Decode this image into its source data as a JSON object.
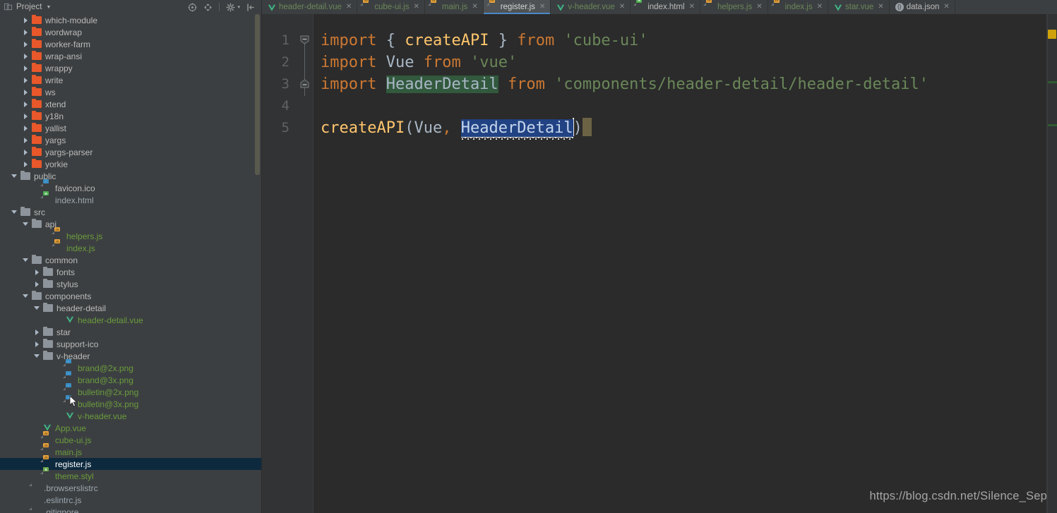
{
  "window": {
    "project_panel_title": "Project",
    "watermark": "https://blog.csdn.net/Silence_Sep"
  },
  "colors": {
    "background": "#2b2b2b",
    "panel": "#3c3f41",
    "selection_row": "#0d293e",
    "active_tab_underline": "#4a88c7",
    "folder_orange": "#e8582a",
    "folder_grey": "#8d949b",
    "text_default": "#bbbbbb",
    "text_vcs_green": "#6a9c3d",
    "vue_teal": "#4fc08d",
    "keyword_orange": "#cc7832",
    "string_green": "#6a8759",
    "function_yellow": "#ffc66d",
    "identifier": "#a9b7c6",
    "code_selection": "#214283",
    "highlight_green": "#32593d",
    "warning_marker": "#cfa20b",
    "change_marker": "#2f5c2f"
  },
  "toolbar": {
    "icons": [
      {
        "name": "locate-icon",
        "title": "Select Opened File"
      },
      {
        "name": "expand-collapse-icon",
        "title": "Expand All"
      },
      {
        "name": "gear-icon",
        "title": "Settings"
      },
      {
        "name": "collapse-panel-icon",
        "title": "Hide"
      }
    ]
  },
  "tabs": [
    {
      "label": "header-detail.vue",
      "icon": "vue-icon",
      "active": false,
      "green": true
    },
    {
      "label": "cube-ui.js",
      "icon": "js-icon",
      "active": false,
      "green": true
    },
    {
      "label": "main.js",
      "icon": "js-icon",
      "active": false,
      "green": true
    },
    {
      "label": "register.js",
      "icon": "js-icon",
      "active": true,
      "green": true
    },
    {
      "label": "v-header.vue",
      "icon": "vue-icon",
      "active": false,
      "green": true
    },
    {
      "label": "index.html",
      "icon": "html-icon",
      "active": false,
      "green": false
    },
    {
      "label": "helpers.js",
      "icon": "js-icon",
      "active": false,
      "green": true
    },
    {
      "label": "index.js",
      "icon": "js-icon",
      "active": false,
      "green": true
    },
    {
      "label": "star.vue",
      "icon": "vue-icon",
      "active": false,
      "green": true
    },
    {
      "label": "data.json",
      "icon": "json-icon",
      "active": false,
      "green": false
    }
  ],
  "tab_close_glyph": "✕",
  "tree": [
    {
      "label": "which-module",
      "indent": 1,
      "type": "folder",
      "folder_color": "orange",
      "arrow": "collapsed",
      "style": "default",
      "selected": false
    },
    {
      "label": "wordwrap",
      "indent": 1,
      "type": "folder",
      "folder_color": "orange",
      "arrow": "collapsed",
      "style": "default",
      "selected": false
    },
    {
      "label": "worker-farm",
      "indent": 1,
      "type": "folder",
      "folder_color": "orange",
      "arrow": "collapsed",
      "style": "default",
      "selected": false
    },
    {
      "label": "wrap-ansi",
      "indent": 1,
      "type": "folder",
      "folder_color": "orange",
      "arrow": "collapsed",
      "style": "default",
      "selected": false
    },
    {
      "label": "wrappy",
      "indent": 1,
      "type": "folder",
      "folder_color": "orange",
      "arrow": "collapsed",
      "style": "default",
      "selected": false
    },
    {
      "label": "write",
      "indent": 1,
      "type": "folder",
      "folder_color": "orange",
      "arrow": "collapsed",
      "style": "default",
      "selected": false
    },
    {
      "label": "ws",
      "indent": 1,
      "type": "folder",
      "folder_color": "orange",
      "arrow": "collapsed",
      "style": "default",
      "selected": false
    },
    {
      "label": "xtend",
      "indent": 1,
      "type": "folder",
      "folder_color": "orange",
      "arrow": "collapsed",
      "style": "default",
      "selected": false
    },
    {
      "label": "y18n",
      "indent": 1,
      "type": "folder",
      "folder_color": "orange",
      "arrow": "collapsed",
      "style": "default",
      "selected": false
    },
    {
      "label": "yallist",
      "indent": 1,
      "type": "folder",
      "folder_color": "orange",
      "arrow": "collapsed",
      "style": "default",
      "selected": false
    },
    {
      "label": "yargs",
      "indent": 1,
      "type": "folder",
      "folder_color": "orange",
      "arrow": "collapsed",
      "style": "default",
      "selected": false
    },
    {
      "label": "yargs-parser",
      "indent": 1,
      "type": "folder",
      "folder_color": "orange",
      "arrow": "collapsed",
      "style": "default",
      "selected": false
    },
    {
      "label": "yorkie",
      "indent": 1,
      "type": "folder",
      "folder_color": "orange",
      "arrow": "collapsed",
      "style": "default",
      "selected": false
    },
    {
      "label": "public",
      "indent": 0,
      "type": "folder",
      "folder_color": "grey",
      "arrow": "expanded",
      "style": "default",
      "selected": false
    },
    {
      "label": "favicon.ico",
      "indent": 2,
      "type": "file",
      "file_icon": "img-icon",
      "arrow": "none",
      "style": "default",
      "selected": false
    },
    {
      "label": "index.html",
      "indent": 2,
      "type": "file",
      "file_icon": "html-icon",
      "arrow": "none",
      "style": "blue",
      "selected": false
    },
    {
      "label": "src",
      "indent": 0,
      "type": "folder",
      "folder_color": "grey",
      "arrow": "expanded",
      "style": "default",
      "selected": false
    },
    {
      "label": "api",
      "indent": 1,
      "type": "folder",
      "folder_color": "grey",
      "arrow": "expanded",
      "style": "default",
      "selected": false
    },
    {
      "label": "helpers.js",
      "indent": 3,
      "type": "file",
      "file_icon": "js-icon",
      "arrow": "none",
      "style": "green",
      "selected": false
    },
    {
      "label": "index.js",
      "indent": 3,
      "type": "file",
      "file_icon": "js-icon",
      "arrow": "none",
      "style": "green",
      "selected": false
    },
    {
      "label": "common",
      "indent": 1,
      "type": "folder",
      "folder_color": "grey",
      "arrow": "expanded",
      "style": "default",
      "selected": false
    },
    {
      "label": "fonts",
      "indent": 2,
      "type": "folder",
      "folder_color": "grey",
      "arrow": "collapsed",
      "style": "default",
      "selected": false
    },
    {
      "label": "stylus",
      "indent": 2,
      "type": "folder",
      "folder_color": "grey",
      "arrow": "collapsed",
      "style": "default",
      "selected": false
    },
    {
      "label": "components",
      "indent": 1,
      "type": "folder",
      "folder_color": "grey",
      "arrow": "expanded",
      "style": "default",
      "selected": false
    },
    {
      "label": "header-detail",
      "indent": 2,
      "type": "folder",
      "folder_color": "grey",
      "arrow": "expanded",
      "style": "default",
      "selected": false
    },
    {
      "label": "header-detail.vue",
      "indent": 4,
      "type": "file",
      "file_icon": "vue-icon",
      "arrow": "none",
      "style": "green",
      "selected": false
    },
    {
      "label": "star",
      "indent": 2,
      "type": "folder",
      "folder_color": "grey",
      "arrow": "collapsed",
      "style": "default",
      "selected": false
    },
    {
      "label": "support-ico",
      "indent": 2,
      "type": "folder",
      "folder_color": "grey",
      "arrow": "collapsed",
      "style": "default",
      "selected": false
    },
    {
      "label": "v-header",
      "indent": 2,
      "type": "folder",
      "folder_color": "grey",
      "arrow": "expanded",
      "style": "default",
      "selected": false
    },
    {
      "label": "brand@2x.png",
      "indent": 4,
      "type": "file",
      "file_icon": "img-icon",
      "arrow": "none",
      "style": "green",
      "selected": false
    },
    {
      "label": "brand@3x.png",
      "indent": 4,
      "type": "file",
      "file_icon": "img-icon",
      "arrow": "none",
      "style": "green",
      "selected": false
    },
    {
      "label": "bulletin@2x.png",
      "indent": 4,
      "type": "file",
      "file_icon": "img-icon",
      "arrow": "none",
      "style": "green",
      "selected": false
    },
    {
      "label": "bulletin@3x.png",
      "indent": 4,
      "type": "file",
      "file_icon": "img-icon",
      "arrow": "none",
      "style": "green",
      "selected": false
    },
    {
      "label": "v-header.vue",
      "indent": 4,
      "type": "file",
      "file_icon": "vue-icon",
      "arrow": "none",
      "style": "green",
      "selected": false
    },
    {
      "label": "App.vue",
      "indent": 2,
      "type": "file",
      "file_icon": "vue-icon",
      "arrow": "none",
      "style": "green",
      "selected": false
    },
    {
      "label": "cube-ui.js",
      "indent": 2,
      "type": "file",
      "file_icon": "js-icon",
      "arrow": "none",
      "style": "green",
      "selected": false
    },
    {
      "label": "main.js",
      "indent": 2,
      "type": "file",
      "file_icon": "js-icon",
      "arrow": "none",
      "style": "green",
      "selected": false
    },
    {
      "label": "register.js",
      "indent": 2,
      "type": "file",
      "file_icon": "js-icon",
      "arrow": "none",
      "style": "green",
      "selected": true
    },
    {
      "label": "theme.styl",
      "indent": 2,
      "type": "file",
      "file_icon": "styl-icon",
      "arrow": "none",
      "style": "green",
      "selected": false
    },
    {
      "label": ".browserslistrc",
      "indent": 1,
      "type": "file",
      "file_icon": "doc-icon",
      "arrow": "none",
      "style": "blue",
      "selected": false
    },
    {
      "label": ".eslintrc.js",
      "indent": 1,
      "type": "file",
      "file_icon": "eslint-icon",
      "arrow": "none",
      "style": "blue",
      "selected": false
    },
    {
      "label": ".gitignore",
      "indent": 1,
      "type": "file",
      "file_icon": "doc-icon",
      "arrow": "none",
      "style": "blue",
      "selected": false
    }
  ],
  "editor": {
    "filename": "register.js",
    "line_numbers": [
      "1",
      "2",
      "3",
      "4",
      "5"
    ],
    "lines": [
      {
        "n": "1",
        "tokens": [
          {
            "t": "import",
            "c": "kw"
          },
          {
            "t": " ",
            "c": "id"
          },
          {
            "t": "{",
            "c": "br"
          },
          {
            "t": " ",
            "c": "id"
          },
          {
            "t": "createAPI",
            "c": "fn"
          },
          {
            "t": " ",
            "c": "id"
          },
          {
            "t": "}",
            "c": "br"
          },
          {
            "t": " ",
            "c": "id"
          },
          {
            "t": "from",
            "c": "kw"
          },
          {
            "t": " ",
            "c": "id"
          },
          {
            "t": "'cube-ui'",
            "c": "str"
          }
        ]
      },
      {
        "n": "2",
        "tokens": [
          {
            "t": "import",
            "c": "kw"
          },
          {
            "t": " ",
            "c": "id"
          },
          {
            "t": "Vue",
            "c": "id"
          },
          {
            "t": " ",
            "c": "id"
          },
          {
            "t": "from",
            "c": "kw"
          },
          {
            "t": " ",
            "c": "id"
          },
          {
            "t": "'vue'",
            "c": "str"
          }
        ]
      },
      {
        "n": "3",
        "tokens": [
          {
            "t": "import",
            "c": "kw"
          },
          {
            "t": " ",
            "c": "id"
          },
          {
            "t": "HeaderDetail",
            "c": "hl-green"
          },
          {
            "t": " ",
            "c": "id"
          },
          {
            "t": "from",
            "c": "kw"
          },
          {
            "t": " ",
            "c": "id"
          },
          {
            "t": "'components/header-detail/header-detail'",
            "c": "str"
          }
        ]
      },
      {
        "n": "4",
        "tokens": []
      },
      {
        "n": "5",
        "tokens": [
          {
            "t": "createAPI",
            "c": "fn"
          },
          {
            "t": "(",
            "c": "br"
          },
          {
            "t": "Vue",
            "c": "id"
          },
          {
            "t": ",",
            "c": "kw"
          },
          {
            "t": " ",
            "c": "id"
          },
          {
            "t": "HeaderDetail",
            "c": "sel"
          },
          {
            "t": ")",
            "c": "br"
          }
        ]
      }
    ],
    "full_text": "import { createAPI } from 'cube-ui'\nimport Vue from 'vue'\nimport HeaderDetail from 'components/header-detail/header-detail'\n\ncreateAPI(Vue, HeaderDetail)"
  }
}
